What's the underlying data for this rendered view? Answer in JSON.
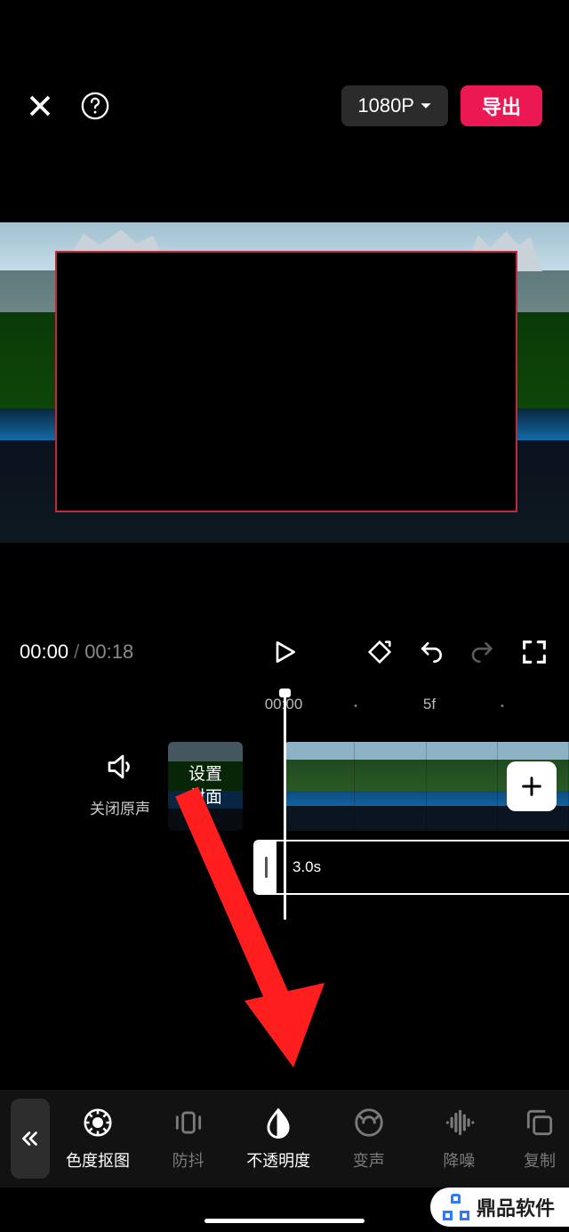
{
  "header": {
    "resolution": "1080P",
    "export": "导出"
  },
  "transport": {
    "current": "00:00",
    "sep": "/",
    "total": "00:18"
  },
  "ruler": {
    "t0": "00:00",
    "t1": "5f"
  },
  "mute": {
    "label": "关闭原声"
  },
  "cover": {
    "label": "设置\n封面"
  },
  "clip": {
    "duration": "3.0s"
  },
  "tools": {
    "chroma": "色度抠图",
    "stabilize": "防抖",
    "opacity": "不透明度",
    "voice": "变声",
    "denoise": "降噪",
    "copy": "复制"
  },
  "watermark": "鼎品软件"
}
